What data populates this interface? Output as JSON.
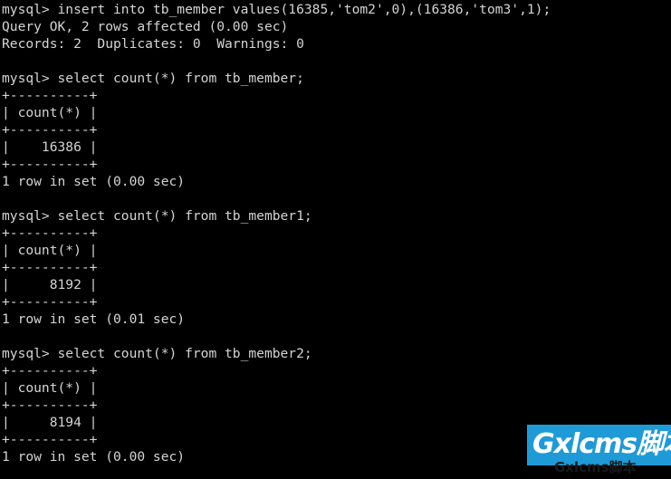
{
  "terminal": {
    "title": "mysql",
    "background_color": "#000000",
    "text_color": "#d4d4d4",
    "prompt": "mysql>",
    "lines": [
      "mysql> insert into tb_member values(16385,'tom2',0),(16386,'tom3',1);",
      "Query OK, 2 rows affected (0.00 sec)",
      "Records: 2  Duplicates: 0  Warnings: 0",
      "",
      "mysql> select count(*) from tb_member;",
      "+----------+",
      "| count(*) |",
      "+----------+",
      "|    16386 |",
      "+----------+",
      "1 row in set (0.00 sec)",
      "",
      "mysql> select count(*) from tb_member1;",
      "+----------+",
      "| count(*) |",
      "+----------+",
      "|     8192 |",
      "+----------+",
      "1 row in set (0.01 sec)",
      "",
      "mysql> select count(*) from tb_member2;",
      "+----------+",
      "| count(*) |",
      "+----------+",
      "|     8194 |",
      "+----------+",
      "1 row in set (0.00 sec)"
    ],
    "statements": [
      {
        "command": "insert into tb_member values(16385,'tom2',0),(16386,'tom3',1);",
        "status": "Query OK, 2 rows affected (0.00 sec)",
        "details": "Records: 2  Duplicates: 0  Warnings: 0"
      },
      {
        "command": "select count(*) from tb_member;",
        "column": "count(*)",
        "value": "16386",
        "footer": "1 row in set (0.00 sec)"
      },
      {
        "command": "select count(*) from tb_member1;",
        "column": "count(*)",
        "value": "8192",
        "footer": "1 row in set (0.01 sec)"
      },
      {
        "command": "select count(*) from tb_member2;",
        "column": "count(*)",
        "value": "8194",
        "footer": "1 row in set (0.00 sec)"
      }
    ]
  },
  "watermark": {
    "label": "Gxlcms脚本",
    "ghost_label": "Gxlcms脚本",
    "background_color": "#1E9BD7",
    "text_color": "#ffffff"
  }
}
